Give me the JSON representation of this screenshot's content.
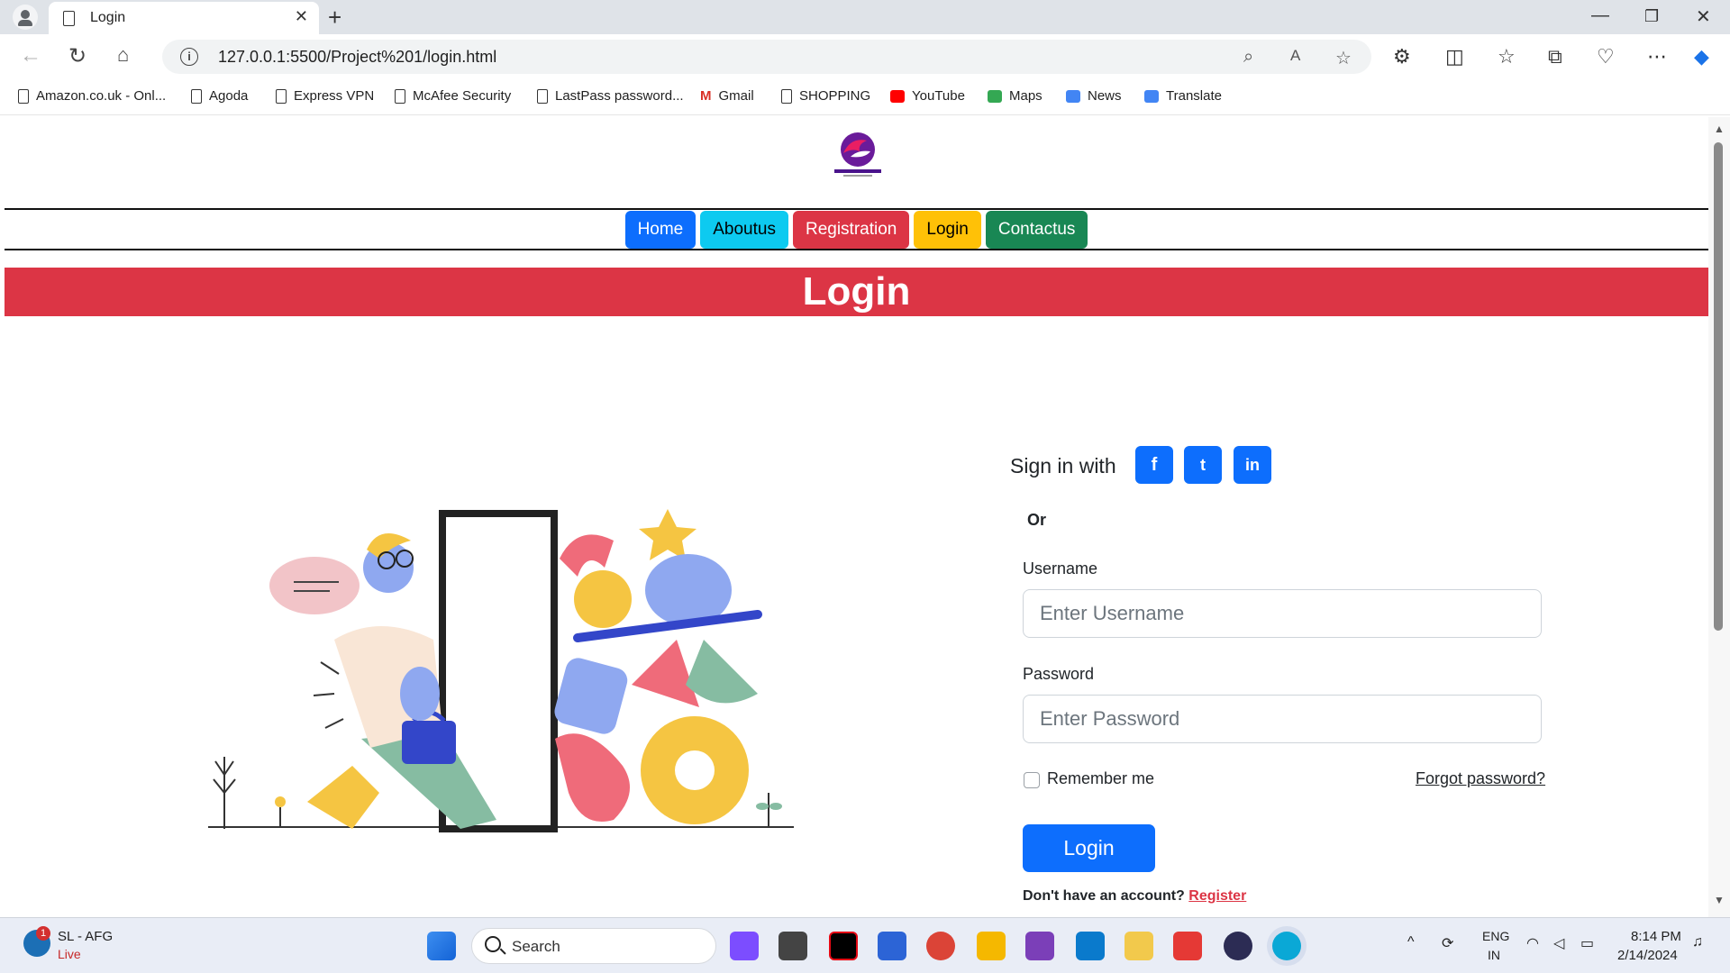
{
  "browser": {
    "tab_title": "Login",
    "url": "127.0.0.1:5500/Project%201/login.html",
    "bookmarks": [
      {
        "label": "Amazon.co.uk - Onl...",
        "icon": "page-icon"
      },
      {
        "label": "Agoda",
        "icon": "page-icon"
      },
      {
        "label": "Express VPN",
        "icon": "page-icon"
      },
      {
        "label": "McAfee Security",
        "icon": "page-icon"
      },
      {
        "label": "LastPass password...",
        "icon": "page-icon"
      },
      {
        "label": "Gmail",
        "icon": "gmail-icon"
      },
      {
        "label": "SHOPPING",
        "icon": "page-icon"
      },
      {
        "label": "YouTube",
        "icon": "youtube-icon"
      },
      {
        "label": "Maps",
        "icon": "maps-icon"
      },
      {
        "label": "News",
        "icon": "news-icon"
      },
      {
        "label": "Translate",
        "icon": "translate-icon"
      }
    ]
  },
  "page": {
    "nav": [
      {
        "label": "Home",
        "color": "#0d6efd"
      },
      {
        "label": "Aboutus",
        "color": "#0dcaf0"
      },
      {
        "label": "Registration",
        "color": "#dc3545"
      },
      {
        "label": "Login",
        "color": "#ffc107"
      },
      {
        "label": "Contactus",
        "color": "#198754"
      }
    ],
    "banner_title": "Login",
    "banner_color": "#dc3545",
    "sign_in_with": "Sign in with",
    "social": [
      "f",
      "t",
      "in"
    ],
    "or": "Or",
    "username_label": "Username",
    "username_placeholder": "Enter Username",
    "password_label": "Password",
    "password_placeholder": "Enter Password",
    "remember_me": "Remember me",
    "forgot_password": "Forgot password?",
    "login_button": "Login",
    "no_account": "Don't have an account?",
    "register_link": "Register",
    "accent": "#0d6efd"
  },
  "taskbar": {
    "weather_title": "SL - AFG",
    "weather_status": "Live",
    "weather_badge": "1",
    "search_label": "Search",
    "lang_line1": "ENG",
    "lang_line2": "IN",
    "time": "8:14 PM",
    "date": "2/14/2024"
  }
}
